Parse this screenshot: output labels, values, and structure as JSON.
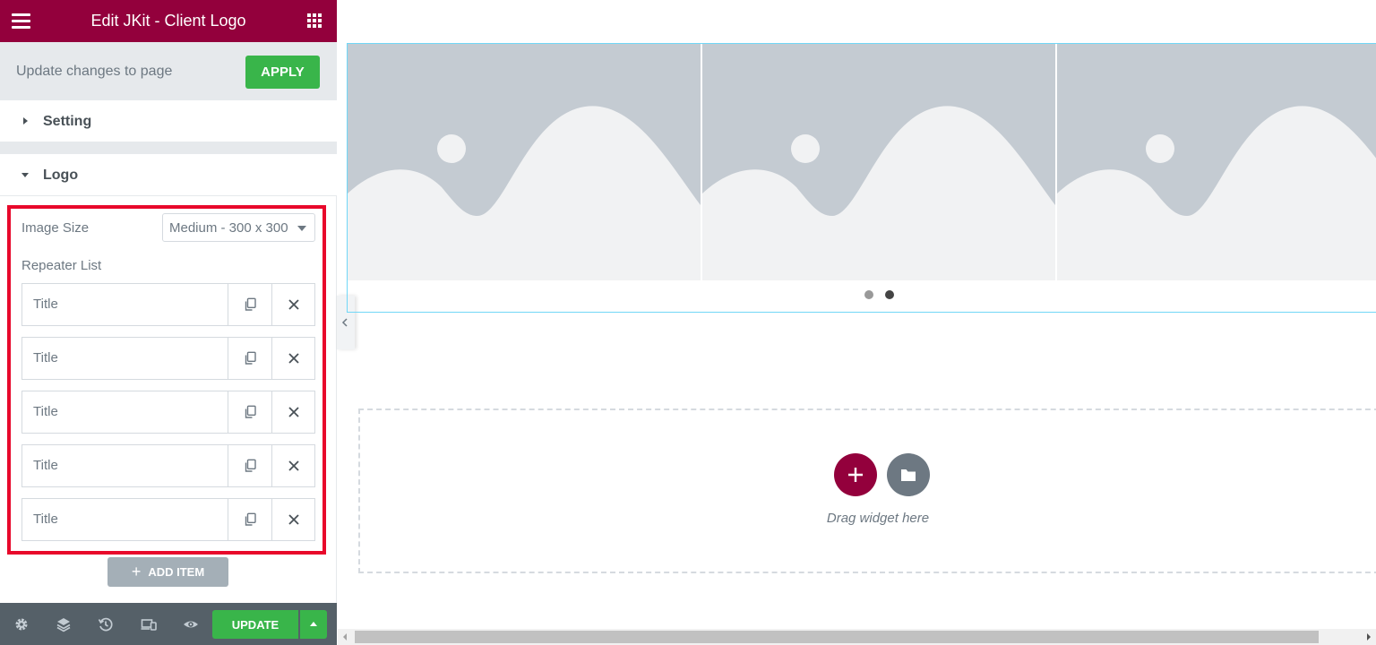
{
  "header": {
    "title": "Edit JKit - Client Logo",
    "menu_icon": "hamburger-icon",
    "widgets_icon": "grid-icon",
    "color": "#93003c"
  },
  "apply_bar": {
    "message": "Update changes to page",
    "button_label": "APPLY"
  },
  "sections": {
    "setting": {
      "label": "Setting",
      "expanded": false
    },
    "logo": {
      "label": "Logo",
      "expanded": true
    }
  },
  "controls": {
    "image_size_label": "Image Size",
    "image_size_value": "Medium - 300 x 300",
    "repeater_label": "Repeater List"
  },
  "repeater_items": [
    {
      "title": "Title"
    },
    {
      "title": "Title"
    },
    {
      "title": "Title"
    },
    {
      "title": "Title"
    },
    {
      "title": "Title"
    }
  ],
  "add_item_label": "ADD ITEM",
  "footer": {
    "icons": [
      "settings-icon",
      "layers-icon",
      "history-icon",
      "responsive-icon",
      "preview-icon"
    ],
    "update_label": "UPDATE"
  },
  "canvas": {
    "drag_text": "Drag widget here",
    "carousel_slides": 3,
    "carousel_dots": 2,
    "active_dot": 2
  },
  "colors": {
    "accent": "#93003c",
    "success": "#39b54a",
    "highlight": "#e8082b",
    "selection": "#71d7f7"
  }
}
